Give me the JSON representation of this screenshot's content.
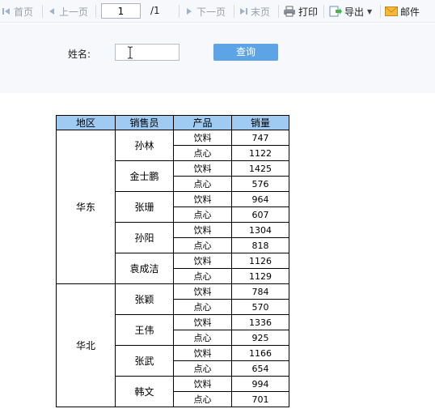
{
  "toolbar": {
    "first": "首页",
    "prev": "上一页",
    "page_value": "1",
    "page_total": "/1",
    "next": "下一页",
    "last": "末页",
    "print": "打印",
    "export": "导出",
    "mail": "邮件"
  },
  "query": {
    "name_label": "姓名:",
    "name_value": "",
    "query_button": "查询"
  },
  "table": {
    "headers": [
      "地区",
      "销售员",
      "产品",
      "销量"
    ],
    "regions": [
      {
        "name": "华东",
        "sellers": [
          {
            "name": "孙林",
            "rows": [
              {
                "product": "饮料",
                "qty": "747"
              },
              {
                "product": "点心",
                "qty": "1122"
              }
            ]
          },
          {
            "name": "金士鹏",
            "rows": [
              {
                "product": "饮料",
                "qty": "1425"
              },
              {
                "product": "点心",
                "qty": "576"
              }
            ]
          },
          {
            "name": "张珊",
            "rows": [
              {
                "product": "饮料",
                "qty": "964"
              },
              {
                "product": "点心",
                "qty": "607"
              }
            ]
          },
          {
            "name": "孙阳",
            "rows": [
              {
                "product": "饮料",
                "qty": "1304"
              },
              {
                "product": "点心",
                "qty": "818"
              }
            ]
          },
          {
            "name": "袁成洁",
            "rows": [
              {
                "product": "饮料",
                "qty": "1126"
              },
              {
                "product": "点心",
                "qty": "1129"
              }
            ]
          }
        ]
      },
      {
        "name": "华北",
        "sellers": [
          {
            "name": "张颖",
            "rows": [
              {
                "product": "饮料",
                "qty": "784"
              },
              {
                "product": "点心",
                "qty": "570"
              }
            ]
          },
          {
            "name": "王伟",
            "rows": [
              {
                "product": "饮料",
                "qty": "1336"
              },
              {
                "product": "点心",
                "qty": "925"
              }
            ]
          },
          {
            "name": "张武",
            "rows": [
              {
                "product": "饮料",
                "qty": "1166"
              },
              {
                "product": "点心",
                "qty": "654"
              }
            ]
          },
          {
            "name": "韩文",
            "rows": [
              {
                "product": "饮料",
                "qty": "994"
              },
              {
                "product": "点心",
                "qty": "701"
              }
            ]
          }
        ]
      }
    ]
  },
  "colors": {
    "header_bg": "#9fcbf2",
    "button_bg": "#5da4e6",
    "toolbar_bg": "#f7f8fb"
  }
}
